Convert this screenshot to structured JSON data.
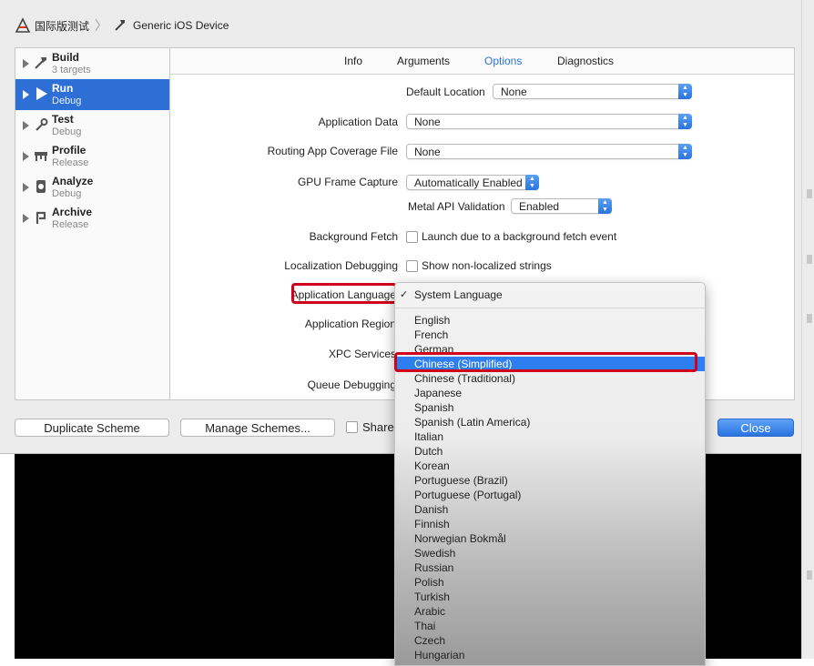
{
  "window": {
    "breadcrumb": {
      "scheme": "国际版测试",
      "destination": "Generic iOS Device"
    }
  },
  "sidebar": {
    "actions": [
      {
        "title": "Build",
        "subtitle": "3 targets"
      },
      {
        "title": "Run",
        "subtitle": "Debug"
      },
      {
        "title": "Test",
        "subtitle": "Debug"
      },
      {
        "title": "Profile",
        "subtitle": "Release"
      },
      {
        "title": "Analyze",
        "subtitle": "Debug"
      },
      {
        "title": "Archive",
        "subtitle": "Release"
      }
    ]
  },
  "tabs": [
    "Info",
    "Arguments",
    "Options",
    "Diagnostics"
  ],
  "options": {
    "default_location": {
      "label": "Default Location",
      "value": "None"
    },
    "application_data": {
      "label": "Application Data",
      "value": "None"
    },
    "routing_coverage": {
      "label": "Routing App Coverage File",
      "value": "None"
    },
    "gpu_frame_capture": {
      "label": "GPU Frame Capture",
      "value": "Automatically Enabled"
    },
    "metal_api": {
      "label": "Metal API Validation",
      "value": "Enabled"
    },
    "background_fetch": {
      "label": "Background Fetch",
      "checkbox_label": "Launch due to a background fetch event"
    },
    "localization_debugging": {
      "label": "Localization Debugging",
      "checkbox_label": "Show non-localized strings"
    },
    "application_language": {
      "label": "Application Language"
    },
    "application_region": {
      "label": "Application Region"
    },
    "xpc_services": {
      "label": "XPC Services"
    },
    "queue_debugging": {
      "label": "Queue Debugging"
    }
  },
  "buttons": {
    "duplicate": "Duplicate Scheme",
    "manage": "Manage Schemes...",
    "shared": "Shared",
    "close": "Close"
  },
  "language_menu": {
    "selected": "System Language",
    "items": [
      "English",
      "French",
      "German",
      "Chinese (Simplified)",
      "Chinese (Traditional)",
      "Japanese",
      "Spanish",
      "Spanish (Latin America)",
      "Italian",
      "Dutch",
      "Korean",
      "Portuguese (Brazil)",
      "Portuguese (Portugal)",
      "Danish",
      "Finnish",
      "Norwegian Bokmål",
      "Swedish",
      "Russian",
      "Polish",
      "Turkish",
      "Arabic",
      "Thai",
      "Czech",
      "Hungarian"
    ],
    "highlighted": "Chinese (Simplified)"
  },
  "colors": {
    "accent": "#2e6fd6",
    "annotation": "#d0011b"
  }
}
